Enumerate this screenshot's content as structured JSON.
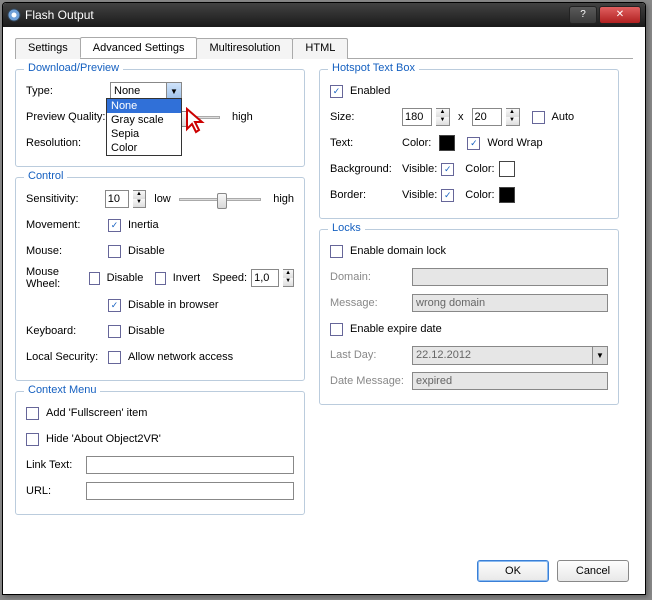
{
  "window": {
    "title": "Flash Output"
  },
  "tabs": {
    "settings": "Settings",
    "advanced": "Advanced Settings",
    "multires": "Multiresolution",
    "html": "HTML"
  },
  "download": {
    "title": "Download/Preview",
    "type_label": "Type:",
    "type_value": "None",
    "type_options": [
      "None",
      "Gray scale",
      "Sepia",
      "Color"
    ],
    "preview_label": "Preview Quality:",
    "high": "high",
    "resolution_label": "Resolution:"
  },
  "control": {
    "title": "Control",
    "sensitivity_label": "Sensitivity:",
    "sensitivity_value": "10",
    "low": "low",
    "high": "high",
    "movement_label": "Movement:",
    "inertia": "Inertia",
    "mouse_label": "Mouse:",
    "disable": "Disable",
    "wheel_label": "Mouse Wheel:",
    "invert": "Invert",
    "speed": "Speed:",
    "speed_value": "1,0",
    "disable_browser": "Disable in browser",
    "keyboard_label": "Keyboard:",
    "local_label": "Local Security:",
    "allow_net": "Allow network access"
  },
  "context": {
    "title": "Context Menu",
    "fullscreen": "Add 'Fullscreen' item",
    "hide_about": "Hide 'About Object2VR'",
    "link_text": "Link Text:",
    "url": "URL:"
  },
  "hotspot": {
    "title": "Hotspot Text Box",
    "enabled": "Enabled",
    "size": "Size:",
    "x": "x",
    "auto": "Auto",
    "w": "180",
    "h": "20",
    "text": "Text:",
    "color": "Color:",
    "wrap": "Word Wrap",
    "bg": "Background:",
    "visible": "Visible:",
    "border": "Border:",
    "text_color": "#000000",
    "bg_color": "#ffffff",
    "border_color": "#000000"
  },
  "locks": {
    "title": "Locks",
    "enable_domain": "Enable domain lock",
    "domain": "Domain:",
    "message": "Message:",
    "message_value": "wrong domain",
    "enable_expire": "Enable expire date",
    "last_day": "Last Day:",
    "last_day_value": "22.12.2012",
    "date_msg": "Date Message:",
    "date_msg_value": "expired"
  },
  "buttons": {
    "ok": "OK",
    "cancel": "Cancel"
  }
}
